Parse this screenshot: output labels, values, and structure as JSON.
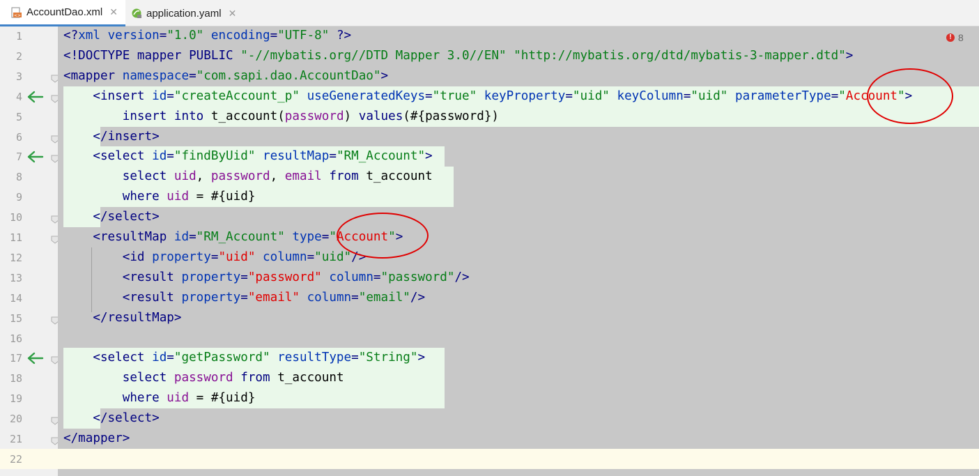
{
  "tabs": [
    {
      "label": "AccountDao.xml",
      "icon": "xml-file-icon",
      "active": true
    },
    {
      "label": "application.yaml",
      "icon": "spring-yaml-icon",
      "active": false
    }
  ],
  "errors": {
    "count": "8"
  },
  "colors": {
    "added_line_bg": "#eaf8ea",
    "editor_bg": "#c8c8c8",
    "annotation": "#e00000"
  },
  "lines": [
    {
      "n": "1",
      "segs": [
        [
          "tag",
          "<?"
        ],
        [
          "attr",
          "xml "
        ],
        [
          "attr",
          "version"
        ],
        [
          "tag",
          "="
        ],
        [
          "str",
          "\"1.0\" "
        ],
        [
          "attr",
          "encoding"
        ],
        [
          "tag",
          "="
        ],
        [
          "str",
          "\"UTF-8\" "
        ],
        [
          "tag",
          "?>"
        ]
      ]
    },
    {
      "n": "2",
      "segs": [
        [
          "tag",
          "<!DOCTYPE mapper PUBLIC "
        ],
        [
          "str",
          "\"-//mybatis.org//DTD Mapper 3.0//EN\" \"http://mybatis.org/dtd/mybatis-3-mapper.dtd\""
        ],
        [
          "tag",
          ">"
        ]
      ]
    },
    {
      "n": "3",
      "segs": [
        [
          "tag",
          "<mapper "
        ],
        [
          "attr",
          "namespace"
        ],
        [
          "tag",
          "="
        ],
        [
          "str",
          "\"com.sapi.dao.AccountDao\""
        ],
        [
          "tag",
          ">"
        ]
      ]
    },
    {
      "n": "4",
      "segs": [
        [
          "tag",
          "    <insert "
        ],
        [
          "attr",
          "id"
        ],
        [
          "tag",
          "="
        ],
        [
          "str",
          "\"createAccount_p\" "
        ],
        [
          "attr",
          "useGeneratedKeys"
        ],
        [
          "tag",
          "="
        ],
        [
          "str",
          "\"true\" "
        ],
        [
          "attr",
          "keyProperty"
        ],
        [
          "tag",
          "="
        ],
        [
          "str",
          "\"uid\" "
        ],
        [
          "attr",
          "keyColumn"
        ],
        [
          "tag",
          "="
        ],
        [
          "str",
          "\"uid\" "
        ],
        [
          "attr",
          "parameterType"
        ],
        [
          "tag",
          "="
        ],
        [
          "str",
          "\""
        ],
        [
          "red",
          "Account"
        ],
        [
          "str",
          "\""
        ],
        [
          "tag",
          ">"
        ]
      ]
    },
    {
      "n": "5",
      "segs": [
        [
          "kw",
          "        insert into "
        ],
        [
          "plain",
          "t_account("
        ],
        [
          "prop",
          "password"
        ],
        [
          "plain",
          ") "
        ],
        [
          "kw",
          "values"
        ],
        [
          "plain",
          "(#{password})"
        ]
      ]
    },
    {
      "n": "6",
      "segs": [
        [
          "tag",
          "    </insert>"
        ]
      ]
    },
    {
      "n": "7",
      "segs": [
        [
          "tag",
          "    <select "
        ],
        [
          "attr",
          "id"
        ],
        [
          "tag",
          "="
        ],
        [
          "str",
          "\"findByUid\" "
        ],
        [
          "attr",
          "resultMap"
        ],
        [
          "tag",
          "="
        ],
        [
          "str",
          "\"RM_Account\""
        ],
        [
          "tag",
          ">"
        ]
      ]
    },
    {
      "n": "8",
      "segs": [
        [
          "kw",
          "        select "
        ],
        [
          "prop",
          "uid"
        ],
        [
          "plain",
          ", "
        ],
        [
          "prop",
          "password"
        ],
        [
          "plain",
          ", "
        ],
        [
          "prop",
          "email "
        ],
        [
          "kw",
          "from "
        ],
        [
          "plain",
          "t_account"
        ]
      ]
    },
    {
      "n": "9",
      "segs": [
        [
          "kw",
          "        where "
        ],
        [
          "prop",
          "uid "
        ],
        [
          "plain",
          "= #{uid}"
        ]
      ]
    },
    {
      "n": "10",
      "segs": [
        [
          "tag",
          "    </select>"
        ]
      ]
    },
    {
      "n": "11",
      "segs": [
        [
          "tag",
          "    <resultMap "
        ],
        [
          "attr",
          "id"
        ],
        [
          "tag",
          "="
        ],
        [
          "str",
          "\"RM_Account\" "
        ],
        [
          "attr",
          "type"
        ],
        [
          "tag",
          "="
        ],
        [
          "str",
          "\""
        ],
        [
          "red",
          "Account"
        ],
        [
          "str",
          "\""
        ],
        [
          "tag",
          ">"
        ]
      ]
    },
    {
      "n": "12",
      "segs": [
        [
          "tag",
          "        <id "
        ],
        [
          "attr",
          "property"
        ],
        [
          "tag",
          "="
        ],
        [
          "red",
          "\"uid\" "
        ],
        [
          "attr",
          "column"
        ],
        [
          "tag",
          "="
        ],
        [
          "str",
          "\"uid\""
        ],
        [
          "tag",
          "/>"
        ]
      ]
    },
    {
      "n": "13",
      "segs": [
        [
          "tag",
          "        <result "
        ],
        [
          "attr",
          "property"
        ],
        [
          "tag",
          "="
        ],
        [
          "red",
          "\"password\" "
        ],
        [
          "attr",
          "column"
        ],
        [
          "tag",
          "="
        ],
        [
          "str",
          "\"password\""
        ],
        [
          "tag",
          "/>"
        ]
      ]
    },
    {
      "n": "14",
      "segs": [
        [
          "tag",
          "        <result "
        ],
        [
          "attr",
          "property"
        ],
        [
          "tag",
          "="
        ],
        [
          "red",
          "\"email\" "
        ],
        [
          "attr",
          "column"
        ],
        [
          "tag",
          "="
        ],
        [
          "str",
          "\"email\""
        ],
        [
          "tag",
          "/>"
        ]
      ]
    },
    {
      "n": "15",
      "segs": [
        [
          "tag",
          "    </resultMap>"
        ]
      ]
    },
    {
      "n": "16",
      "segs": []
    },
    {
      "n": "17",
      "segs": [
        [
          "tag",
          "    <select "
        ],
        [
          "attr",
          "id"
        ],
        [
          "tag",
          "="
        ],
        [
          "str",
          "\"getPassword\" "
        ],
        [
          "attr",
          "resultType"
        ],
        [
          "tag",
          "="
        ],
        [
          "str",
          "\"String\""
        ],
        [
          "tag",
          ">"
        ]
      ]
    },
    {
      "n": "18",
      "segs": [
        [
          "kw",
          "        select "
        ],
        [
          "prop",
          "password "
        ],
        [
          "kw",
          "from "
        ],
        [
          "plain",
          "t_account"
        ]
      ]
    },
    {
      "n": "19",
      "segs": [
        [
          "kw",
          "        where "
        ],
        [
          "prop",
          "uid "
        ],
        [
          "plain",
          "= #{uid}"
        ]
      ]
    },
    {
      "n": "20",
      "segs": [
        [
          "tag",
          "    </select>"
        ]
      ]
    },
    {
      "n": "21",
      "segs": [
        [
          "tag",
          "</mapper>"
        ]
      ]
    },
    {
      "n": "22",
      "segs": []
    }
  ],
  "implemented_markers": [
    "4",
    "7",
    "17"
  ]
}
